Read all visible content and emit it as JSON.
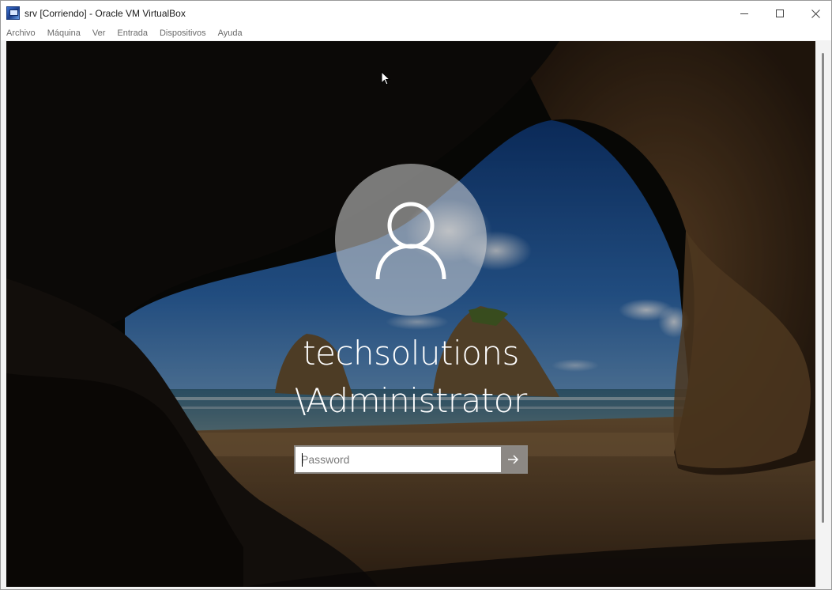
{
  "window": {
    "title": "srv [Corriendo] - Oracle VM VirtualBox",
    "app_icon": "virtualbox-icon",
    "controls": [
      "minimize-icon",
      "maximize-icon",
      "close-icon"
    ]
  },
  "menubar": {
    "items": [
      "Archivo",
      "Máquina",
      "Ver",
      "Entrada",
      "Dispositivos",
      "Ayuda"
    ]
  },
  "lockscreen": {
    "avatar_icon": "user-icon",
    "username_line1": "techsolutions",
    "username_line2": "\\Administrator",
    "password": {
      "value": "",
      "placeholder": "Password"
    },
    "submit_icon": "arrow-right-icon"
  },
  "colors": {
    "titlebar_bg": "#ffffff",
    "menu_text": "#6a6a6a",
    "avatar_bg": "#d7d7d7",
    "submit_bg": "#8c8884"
  }
}
